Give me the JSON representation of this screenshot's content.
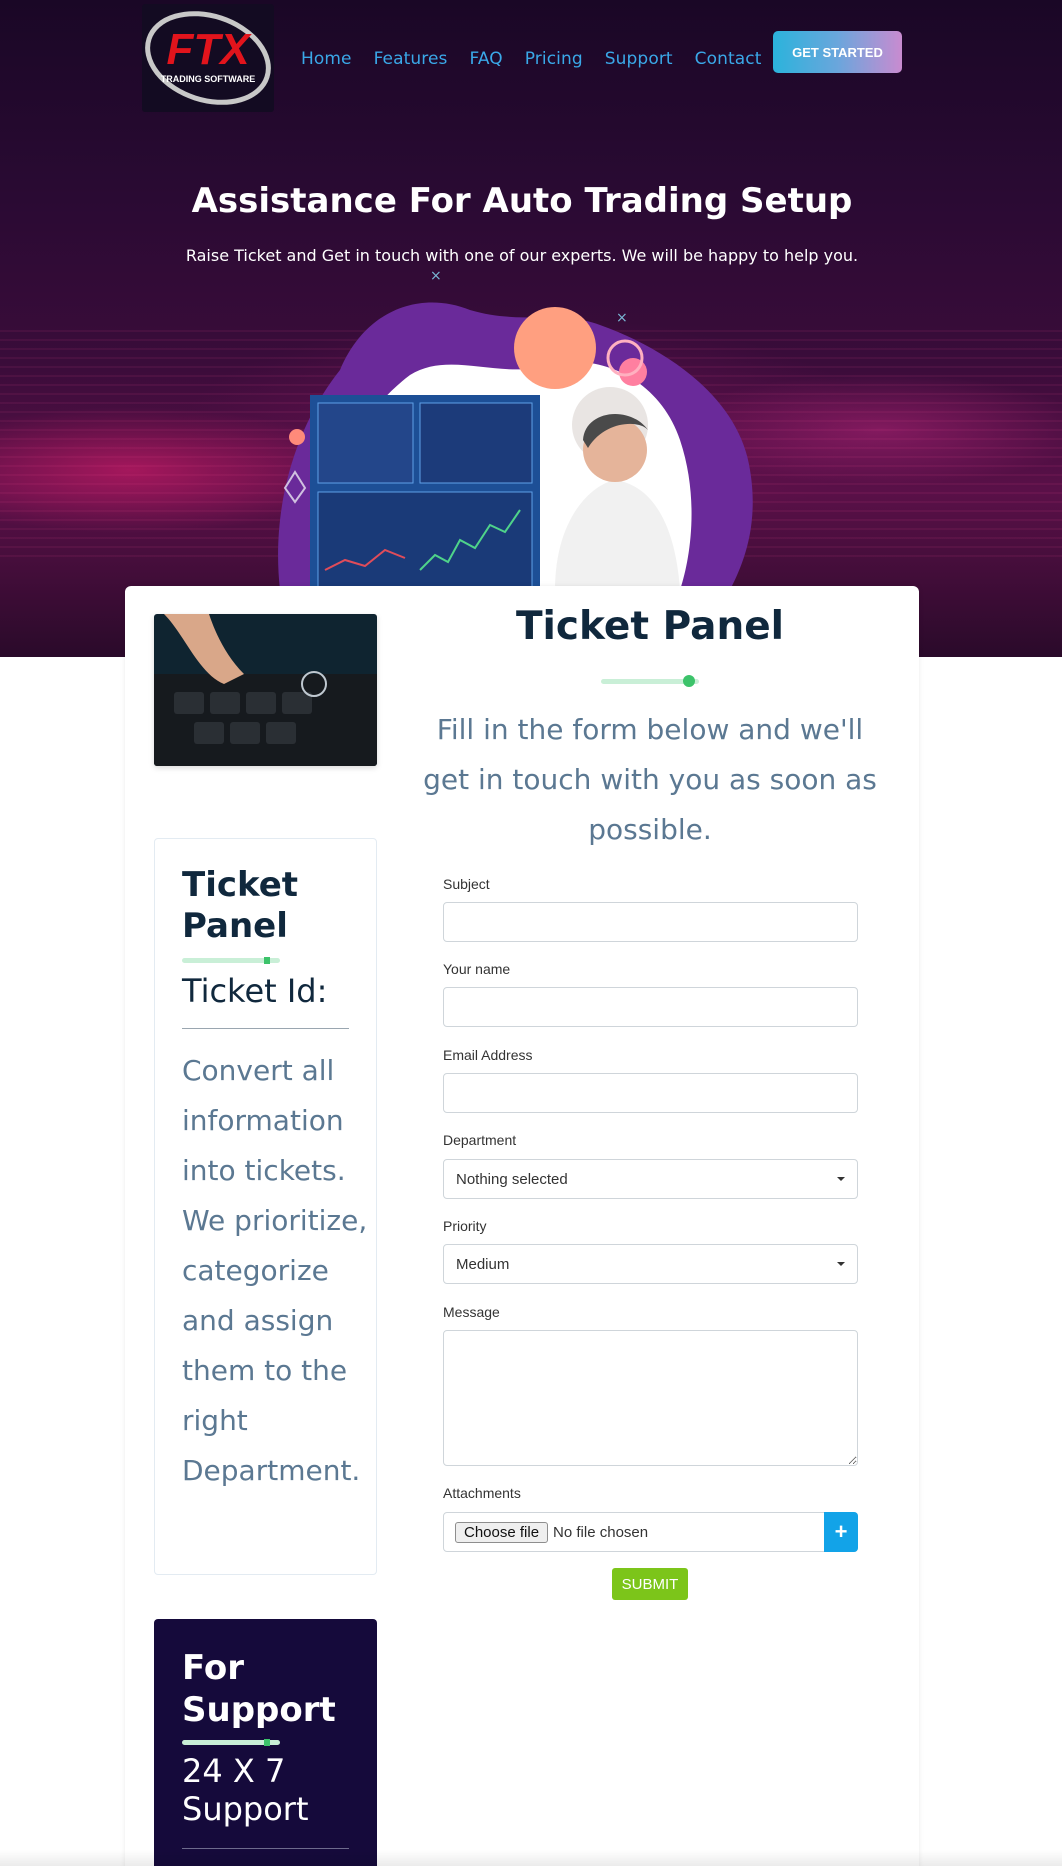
{
  "brand": {
    "logo_text": "FTX",
    "logo_subtext": "TRADING SOFTWARE"
  },
  "nav": {
    "items": [
      "Home",
      "Features",
      "FAQ",
      "Pricing",
      "Support",
      "Contact"
    ],
    "cta_label": "GET STARTED"
  },
  "hero": {
    "title": "Assistance For Auto Trading Setup",
    "subtitle": "Raise Ticket and Get in touch with one of our experts. We will be happy to help you."
  },
  "sidebar": {
    "panel_title": "Ticket Panel",
    "ticket_id_label": "Ticket Id:",
    "description": "Convert all information into tickets. We prioritize, categorize and assign them to the right Department.",
    "support_title": "For Support",
    "support_hours": "24 X 7 Support"
  },
  "form": {
    "title": "Ticket Panel",
    "intro": "Fill in the form below and we'll get in touch with you as soon as possible.",
    "subject_label": "Subject",
    "subject_value": "",
    "name_label": "Your name",
    "name_value": "",
    "email_label": "Email Address",
    "email_value": "",
    "department_label": "Department",
    "department_value": "Nothing selected",
    "priority_label": "Priority",
    "priority_value": "Medium",
    "message_label": "Message",
    "message_value": "",
    "attachments_label": "Attachments",
    "choose_file_label": "Choose file",
    "no_file_text": "No file chosen",
    "add_attachment_symbol": "+",
    "submit_label": "SUBMIT"
  },
  "colors": {
    "accent_green": "#7cc51a",
    "accent_blue": "#12a3e8",
    "nav_blue": "#3aa8e8",
    "heading_dark": "#10283d",
    "muted_text": "#5b7892",
    "support_bg": "#150a3b"
  }
}
